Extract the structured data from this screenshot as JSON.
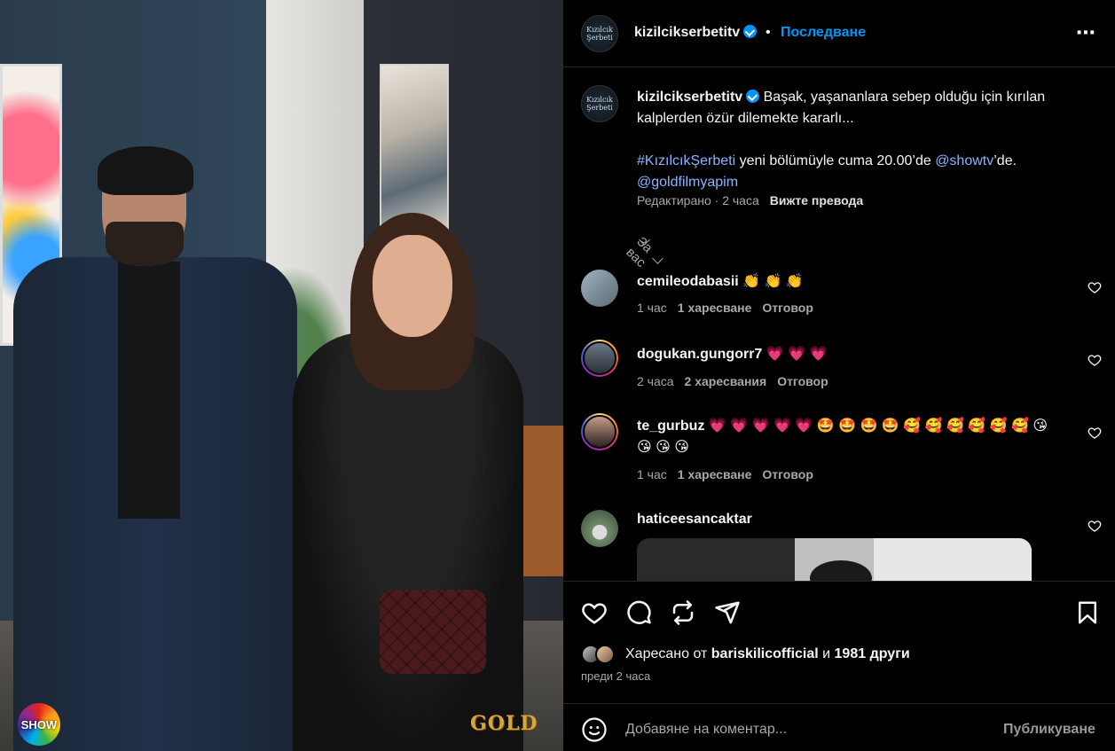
{
  "colors": {
    "accent": "#0095f6",
    "link": "#8ab4ff",
    "muted": "#a8a8a8",
    "background": "#000000"
  },
  "media": {
    "show_logo": "SHOW",
    "gold_logo": "GOLD"
  },
  "header": {
    "username": "kizilcikserbetitv",
    "separator": "•",
    "follow_label": "Последване",
    "more_icon": "⋯",
    "avatar_text": "Kızılcık Şerbeti"
  },
  "caption": {
    "username": "kizilcikserbetitv",
    "text_1": "Başak, yaşananlara sebep olduğu için kırılan kalplerden özür dilemekte kararlı...",
    "hashtag": "#KızılcıkŞerbeti",
    "text_2": " yeni bölümüyle cuma 20.00’de ",
    "mention_1": "@showtv",
    "text_3": "’de.",
    "mention_2": "@goldfilmyapim",
    "edited": "Редактирано · 2 часа",
    "translate": "Вижте превода"
  },
  "for_you": "За вас",
  "comments": [
    {
      "user": "cemileodabasii",
      "text": "👏 👏 👏",
      "time": "1 час",
      "likes": "1 харесване",
      "reply": "Отговор"
    },
    {
      "user": "dogukan.gungorr7",
      "text": "💗 💗 💗",
      "time": "2 часа",
      "likes": "2 харесвания",
      "reply": "Отговор"
    },
    {
      "user": "te_gurbuz",
      "text": "💗 💗 💗 💗 💗 🤩 🤩 🤩 🤩 🥰 🥰 🥰 🥰 🥰 🥰 😘 😘 😘 😘",
      "time": "1 час",
      "likes": "1 харесване",
      "reply": "Отговор"
    },
    {
      "user": "haticeesancaktar",
      "text": ""
    }
  ],
  "actions": {
    "like_icon": "heart-icon",
    "comment_icon": "comment-icon",
    "repost_icon": "repost-icon",
    "share_icon": "send-icon",
    "save_icon": "bookmark-icon"
  },
  "likes": {
    "prefix": "Харесано от ",
    "user": "bariskilicofficial",
    "middle": " и ",
    "others": "1981 други"
  },
  "posted_ago": "преди 2 часа",
  "add_comment": {
    "placeholder": "Добавяне на коментар...",
    "publish_label": "Публикуване"
  }
}
